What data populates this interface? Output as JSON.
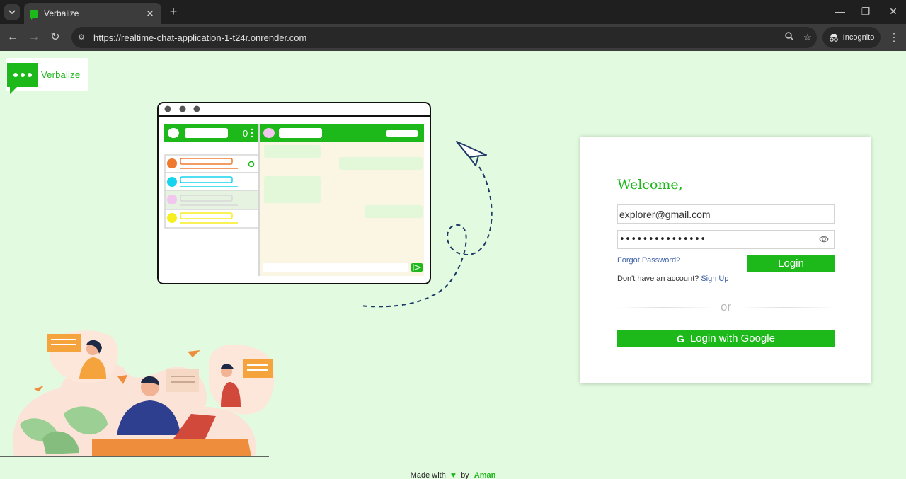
{
  "browser": {
    "tab_title": "Verbalize",
    "url": "https://realtime-chat-application-1-t24r.onrender.com",
    "incognito_label": "Incognito"
  },
  "logo": {
    "text": "Verbalize"
  },
  "login": {
    "welcome": "Welcome,",
    "email_value": "explorer@gmail.com",
    "password_value": "•••••••••••••••",
    "forgot_label": "Forgot Password?",
    "login_label": "Login",
    "no_account_text": "Don't have an account?",
    "signup_label": "Sign Up",
    "or_text": "or",
    "google_label": "Login with Google",
    "google_icon": "G"
  },
  "footer": {
    "made_with": "Made with",
    "by": "by",
    "author": "Aman"
  },
  "colors": {
    "brand": "#1db81a",
    "background": "#e2fbe0",
    "link": "#3c5fa5"
  }
}
